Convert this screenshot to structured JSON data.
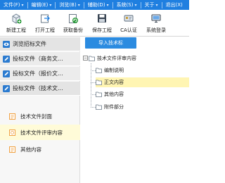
{
  "menu": {
    "items": [
      {
        "label": "文件(F)"
      },
      {
        "label": "编辑(E)"
      },
      {
        "label": "浏览(B)"
      },
      {
        "label": "辅助(D)"
      },
      {
        "label": "系统(S)"
      },
      {
        "label": "关于"
      },
      {
        "label": "退出(X)"
      }
    ]
  },
  "toolbar": {
    "new_project": "新建工程",
    "open_project": "打开工程",
    "get_backup": "获取备份",
    "save_project": "保存工程",
    "ca_auth": "CA认证",
    "system_login": "系统登录"
  },
  "nav": {
    "browse_tender": "浏览招标文件",
    "bid_business": "投标文件（商务文...",
    "bid_price": "投标文件（报价文...",
    "bid_technical": "投标文件（技术文...",
    "sub_items": [
      {
        "label": "技术文件封面"
      },
      {
        "label": "技术文件评审内容"
      },
      {
        "label": "其他内容"
      }
    ]
  },
  "right": {
    "import_button": "导入技术标",
    "tree_root": "技术文件评审内容",
    "tree_children": [
      {
        "label": "编制说明"
      },
      {
        "label": "正文内容"
      },
      {
        "label": "其他内容"
      },
      {
        "label": "附件部分"
      }
    ]
  },
  "colors": {
    "menubar": "#1f7fe0",
    "accent": "#2b8be0",
    "selected_row": "#fffbd8",
    "selected_node": "#fff5b3",
    "sub_icon_orange": "#f0a040"
  }
}
